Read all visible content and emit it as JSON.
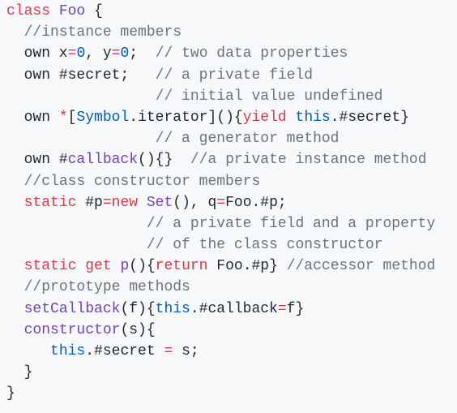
{
  "theme": {
    "background": "#f6f8fa",
    "default": "#24292e",
    "keyword": "#d73a49",
    "class_name": "#6f42c1",
    "comment": "#6a737d",
    "number": "#005cc5",
    "builtin": "#005cc5"
  },
  "lines": [
    [
      [
        "class",
        "keyword"
      ],
      [
        " "
      ],
      [
        "Foo",
        "class_name"
      ],
      [
        " {"
      ]
    ],
    [
      [
        "  "
      ],
      [
        "//instance members",
        "comment"
      ]
    ],
    [
      [
        "  own x"
      ],
      [
        "=",
        "keyword"
      ],
      [
        "0",
        "number"
      ],
      [
        ", y"
      ],
      [
        "=",
        "keyword"
      ],
      [
        "0",
        "number"
      ],
      [
        ";  "
      ],
      [
        "// two data properties",
        "comment"
      ]
    ],
    [
      [
        "  own #secret;   "
      ],
      [
        "// a private field",
        "comment"
      ]
    ],
    [
      [
        "                 "
      ],
      [
        "// initial value undefined",
        "comment"
      ]
    ],
    [
      [
        "  own "
      ],
      [
        "*",
        "keyword"
      ],
      [
        "["
      ],
      [
        "Symbol",
        "builtin"
      ],
      [
        ".iterator](){"
      ],
      [
        "yield",
        "keyword"
      ],
      [
        " "
      ],
      [
        "this",
        "builtin"
      ],
      [
        ".#secret}"
      ]
    ],
    [
      [
        "                 "
      ],
      [
        "// a generator method",
        "comment"
      ]
    ],
    [
      [
        "  own #"
      ],
      [
        "callback",
        "class_name"
      ],
      [
        "(){}  "
      ],
      [
        "//a private instance method",
        "comment"
      ]
    ],
    [
      [
        "  "
      ],
      [
        "//class constructor members",
        "comment"
      ]
    ],
    [
      [
        "  "
      ],
      [
        "static",
        "keyword"
      ],
      [
        " #p"
      ],
      [
        "=",
        "keyword"
      ],
      [
        "new",
        "keyword"
      ],
      [
        " "
      ],
      [
        "Set",
        "class_name"
      ],
      [
        "(), q"
      ],
      [
        "=",
        "keyword"
      ],
      [
        "Foo.#p;"
      ]
    ],
    [
      [
        "                "
      ],
      [
        "// a private field and a property",
        "comment"
      ]
    ],
    [
      [
        "                "
      ],
      [
        "// of the class constructor",
        "comment"
      ]
    ],
    [
      [
        "  "
      ],
      [
        "static",
        "keyword"
      ],
      [
        " "
      ],
      [
        "get",
        "keyword"
      ],
      [
        " "
      ],
      [
        "p",
        "class_name"
      ],
      [
        "(){"
      ],
      [
        "return",
        "keyword"
      ],
      [
        " Foo.#p} "
      ],
      [
        "//accessor method",
        "comment"
      ]
    ],
    [
      [
        "  "
      ],
      [
        "//prototype methods",
        "comment"
      ]
    ],
    [
      [
        "  "
      ],
      [
        "setCallback",
        "class_name"
      ],
      [
        "(f){"
      ],
      [
        "this",
        "builtin"
      ],
      [
        ".#callback"
      ],
      [
        "=",
        "keyword"
      ],
      [
        "f}"
      ]
    ],
    [
      [
        "  "
      ],
      [
        "constructor",
        "class_name"
      ],
      [
        "(s){"
      ]
    ],
    [
      [
        "     "
      ],
      [
        "this",
        "builtin"
      ],
      [
        ".#secret "
      ],
      [
        "=",
        "keyword"
      ],
      [
        " s;"
      ]
    ],
    [
      [
        "  }"
      ]
    ],
    [
      [
        "}"
      ]
    ]
  ]
}
